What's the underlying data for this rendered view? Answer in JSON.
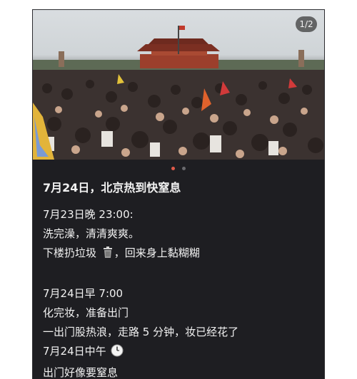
{
  "post": {
    "image_counter": "1/2",
    "title": "7月24日，北京热到快窒息",
    "lines": [
      "7月23日晚 23:00:",
      "洗完澡，清清爽爽。",
      "下楼扔垃圾",
      "，回来身上黏糊糊",
      "",
      "7月24日早 7:00",
      "化完妆，准备出门",
      "一出门股热浪，走路 5 分钟，妆已经花了",
      "7月24日中午",
      "出门好像要窒息"
    ],
    "icons": [
      "trash-can-icon",
      "clock-icon"
    ],
    "accent_color": "#e05a4a"
  }
}
